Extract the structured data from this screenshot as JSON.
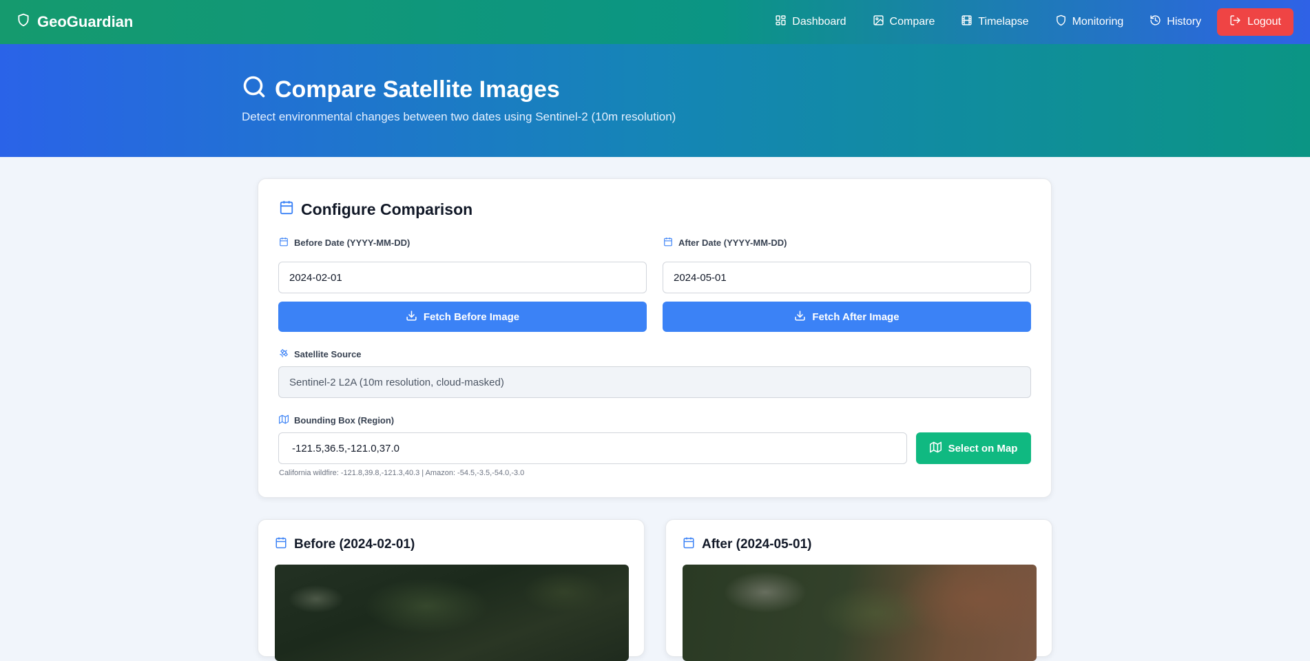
{
  "navbar": {
    "brand": "GeoGuardian",
    "links": [
      {
        "label": "Dashboard"
      },
      {
        "label": "Compare"
      },
      {
        "label": "Timelapse"
      },
      {
        "label": "Monitoring"
      },
      {
        "label": "History"
      }
    ],
    "logout_label": "Logout"
  },
  "hero": {
    "title": "Compare Satellite Images",
    "subtitle": "Detect environmental changes between two dates using Sentinel-2 (10m resolution)"
  },
  "config": {
    "title": "Configure Comparison",
    "before_label": "Before Date (YYYY-MM-DD)",
    "before_value": "2024-02-01",
    "after_label": "After Date (YYYY-MM-DD)",
    "after_value": "2024-05-01",
    "fetch_before_label": "Fetch Before Image",
    "fetch_after_label": "Fetch After Image",
    "source_label": "Satellite Source",
    "source_value": "Sentinel-2 L2A (10m resolution, cloud-masked)",
    "bbox_label": "Bounding Box (Region)",
    "bbox_value": "-121.5,36.5,-121.0,37.0",
    "select_map_label": "Select on Map",
    "bbox_hint": "California wildfire: -121.8,39.8,-121.3,40.3 | Amazon: -54.5,-3.5,-54.0,-3.0"
  },
  "before_card": {
    "title": "Before (2024-02-01)"
  },
  "after_card": {
    "title": "After (2024-05-01)"
  },
  "colors": {
    "primary": "#3b82f6",
    "success": "#10b981",
    "danger": "#ef4444"
  }
}
